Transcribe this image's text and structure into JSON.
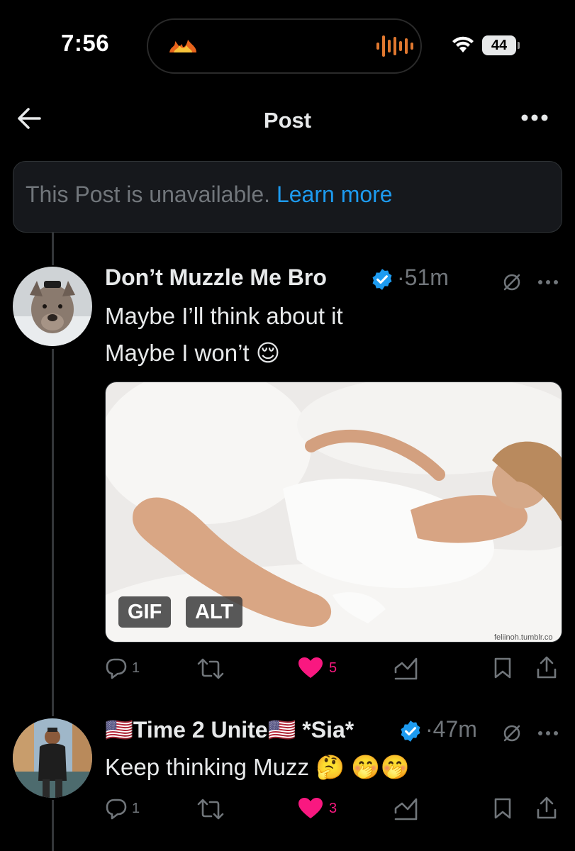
{
  "status_bar": {
    "time": "7:56",
    "battery": "44"
  },
  "header": {
    "title": "Post"
  },
  "notice": {
    "text": "This Post is unavailable.",
    "link": "Learn more"
  },
  "posts": [
    {
      "author": "Don’t Muzzle Me Bro",
      "time": "51m",
      "lines": [
        "Maybe I’ll think about it",
        "Maybe I won’t 😌"
      ],
      "media": {
        "gif_label": "GIF",
        "alt_label": "ALT",
        "watermark": "feliinoh.tumblr.co"
      },
      "replies": "1",
      "likes": "5"
    },
    {
      "author_flag_left": "🇺🇸",
      "author": "Time 2 Unite",
      "author_flag_right": "🇺🇸",
      "author_suffix": "*Sia*",
      "time": "47m",
      "text": "Keep thinking Muzz 🤔 🤭🤭",
      "replies": "1",
      "likes": "3"
    }
  ],
  "colors": {
    "accent": "#1d9bf0",
    "like": "#f91880",
    "muted": "#71767b",
    "text": "#e7e9ea",
    "island_bars": "#e0782f"
  },
  "icons": [
    "back-arrow-icon",
    "more-icon",
    "verified-icon",
    "grok-icon",
    "reply-icon",
    "repost-icon",
    "heart-icon",
    "views-icon",
    "bookmark-icon",
    "share-icon"
  ]
}
